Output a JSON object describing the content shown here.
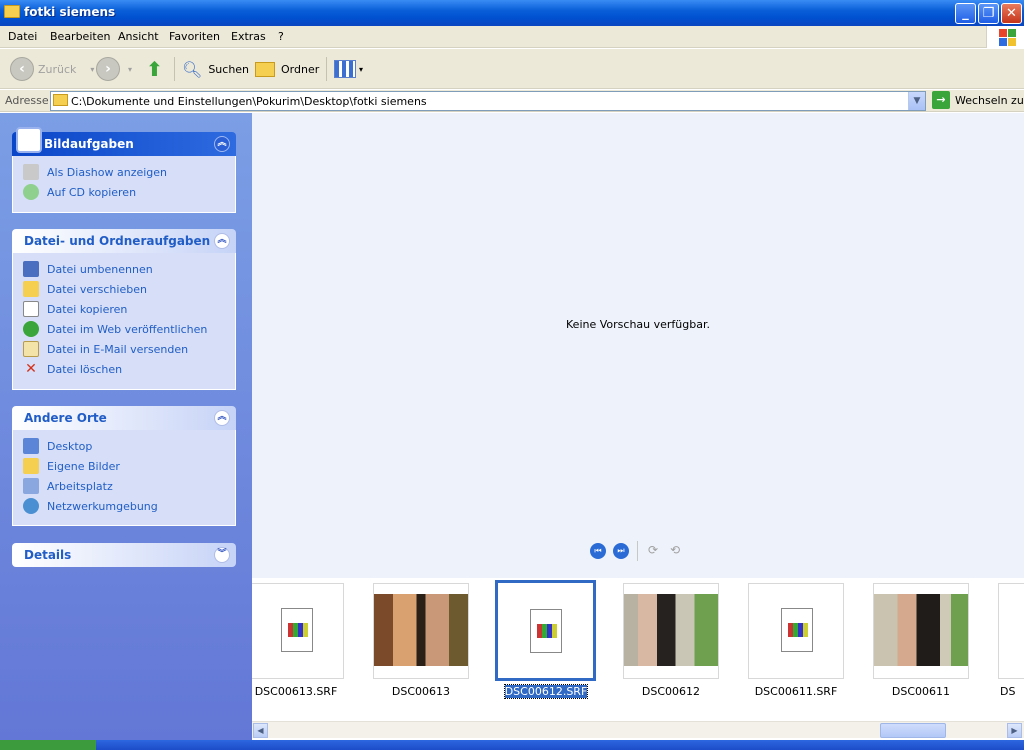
{
  "window": {
    "title": "fotki siemens"
  },
  "menu": [
    "Datei",
    "Bearbeiten",
    "Ansicht",
    "Favoriten",
    "Extras",
    "?"
  ],
  "toolbar": {
    "back": "Zurück",
    "search": "Suchen",
    "folders": "Ordner"
  },
  "address": {
    "label": "Adresse",
    "path": "C:\\Dokumente und Einstellungen\\Pokurim\\Desktop\\fotki siemens",
    "go": "Wechseln zu"
  },
  "panels": {
    "picture_tasks": {
      "title": "Bildaufgaben",
      "items": [
        "Als Diashow anzeigen",
        "Auf CD kopieren"
      ]
    },
    "file_tasks": {
      "title": "Datei- und Ordneraufgaben",
      "items": [
        "Datei umbenennen",
        "Datei verschieben",
        "Datei kopieren",
        "Datei im Web veröffentlichen",
        "Datei in E-Mail versenden",
        "Datei löschen"
      ]
    },
    "other_places": {
      "title": "Andere Orte",
      "items": [
        "Desktop",
        "Eigene Bilder",
        "Arbeitsplatz",
        "Netzwerkumgebung"
      ]
    },
    "details": {
      "title": "Details"
    }
  },
  "preview": {
    "message": "Keine Vorschau verfügbar."
  },
  "files": [
    "DSC00613.SRF",
    "DSC00613",
    "DSC00612.SRF",
    "DSC00612",
    "DSC00611.SRF",
    "DSC00611",
    "DS"
  ],
  "selected_file": "DSC00612.SRF"
}
